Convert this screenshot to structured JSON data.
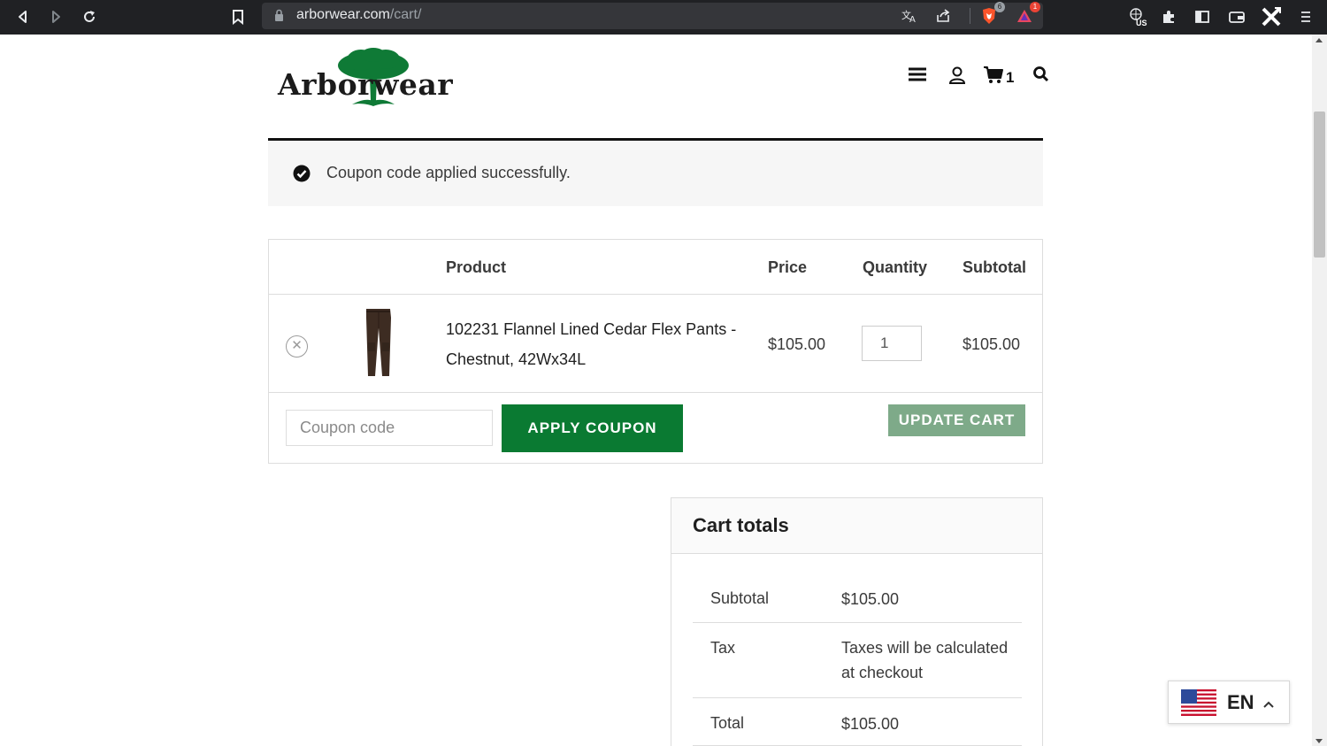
{
  "browser": {
    "url_host": "arborwear.com",
    "url_path": "/cart/",
    "brave_badge": "6",
    "alert_badge": "1",
    "vpn_region": "US"
  },
  "header": {
    "logo_text": "Arborwear",
    "cart_count": "1"
  },
  "notice": {
    "message": "Coupon code applied successfully."
  },
  "cart_table": {
    "headers": {
      "product": "Product",
      "price": "Price",
      "quantity": "Quantity",
      "subtotal": "Subtotal"
    },
    "items": [
      {
        "name": "102231 Flannel Lined Cedar Flex Pants - Chestnut, 42Wx34L",
        "price": "$105.00",
        "quantity": "1",
        "subtotal": "$105.00"
      }
    ],
    "coupon_placeholder": "Coupon code",
    "apply_label": "APPLY COUPON",
    "update_label": "UPDATE CART"
  },
  "totals": {
    "title": "Cart totals",
    "rows": [
      {
        "label": "Subtotal",
        "value": "$105.00"
      },
      {
        "label": "Tax",
        "value": "Taxes will be calculated at checkout"
      },
      {
        "label": "Total",
        "value": "$105.00"
      }
    ]
  },
  "language": {
    "code": "EN"
  },
  "colors": {
    "brand_green": "#0a7a32",
    "update_button": "#7eaa89",
    "toolbar": "#202124"
  }
}
